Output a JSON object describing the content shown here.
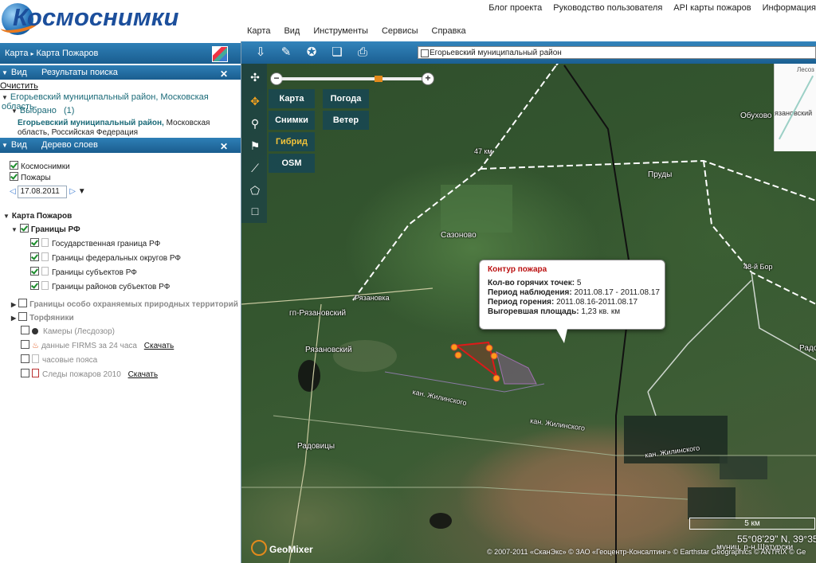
{
  "header": {
    "brand": "Космоснимки",
    "top_links": [
      "Блог проекта",
      "Руководство пользователя",
      "API карты пожаров",
      "Информация"
    ],
    "main_menu": [
      "Карта",
      "Вид",
      "Инструменты",
      "Сервисы",
      "Справка"
    ]
  },
  "breadcrumb": {
    "root": "Карта",
    "current": "Карта Пожаров"
  },
  "search_panel": {
    "view_label": "Вид",
    "title": "Результаты поиска",
    "clear_link": "Очистить",
    "region_line": "Егорьевский муниципальный район, Московская область",
    "selected_label": "Выбрано",
    "selected_count": "(1)",
    "result_name": "Егорьевский муниципальный район,",
    "result_rest1": " Московская",
    "result_rest2": "область, Российская Федерация"
  },
  "layers_panel": {
    "view_label": "Вид",
    "title": "Дерево слоев",
    "base_layers": [
      "Космоснимки",
      "Пожары"
    ],
    "date": "17.08.2011",
    "group_title": "Карта Пожаров",
    "borders_group": "Границы РФ",
    "borders_items": [
      "Государственная граница РФ",
      "Границы федеральных округов РФ",
      "Границы субъектов РФ",
      "Границы районов субъектов РФ"
    ],
    "protected": "Границы особо охраняемых природных территорий",
    "peat": "Торфяники",
    "cameras": "Камеры (Лесдозор)",
    "firms": "данные FIRMS за 24 часа",
    "timezones": "часовые пояса",
    "traces": "Следы пожаров 2010",
    "download": "Скачать"
  },
  "map": {
    "search_value": "Егорьевский муниципальный район",
    "basemaps": [
      "Карта",
      "Снимки",
      "Гибрид",
      "OSM"
    ],
    "overlays": [
      "Погода",
      "Ветер"
    ],
    "selected_basemap": "Гибрид",
    "places": {
      "sazonovo": "Сазоново",
      "prudy": "Пруды",
      "obukhovo": "Обухово",
      "ryazanovka": "Рязановка",
      "gp_ryazanovsky": "гп-Рязановский",
      "ryazanovsky": "Рязановский",
      "radovitsy": "Радовицы",
      "kan1": "кан. Жилинского",
      "kan2": "кан. Жилинского",
      "kan3": "кан. Жилинского",
      "km": "47 км",
      "bor": "48-й Бор",
      "rado": "Радо",
      "lesoz": "Лесоз",
      "ryazanovsky_mini": "язановский"
    },
    "popup": {
      "title": "Контур пожара",
      "hotspots_label": "Кол-во горячих точек:",
      "hotspots_value": "5",
      "obs_label": "Период наблюдения:",
      "obs_value": "2011.08.17 - 2011.08.17",
      "burn_label": "Период горения:",
      "burn_value": "2011.08.16-2011.08.17",
      "area_label": "Выгоревшая площадь:",
      "area_value": "1,23 кв. км"
    },
    "scale": "5 км",
    "coords": "55°08'29\" N, 39°35'",
    "municipality": "муниц. р-н Шатурски",
    "copyright": "© 2007-2011 «СканЭкс» © ЗАО «Геоцентр-Консалтинг» © Earthstar Geographics © ANTRIX © Ge",
    "geomixer": "GeoMixer"
  }
}
